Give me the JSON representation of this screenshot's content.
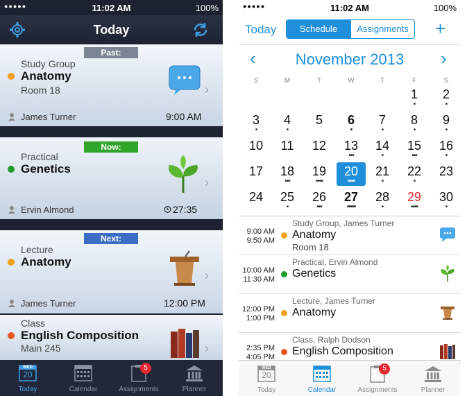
{
  "left": {
    "status": {
      "signal": "●●●●●",
      "time": "11:02 AM",
      "battery": "100%"
    },
    "header": {
      "title": "Today"
    },
    "cards": [
      {
        "tag": "Past:",
        "type": "Study Group",
        "name": "Anatomy",
        "room": "Room 18",
        "person": "James Turner",
        "time": "9:00 AM",
        "dot": "#f0a020",
        "icon": "speech-bubble-icon"
      },
      {
        "tag": "Now:",
        "type": "Practical",
        "name": "Genetics",
        "room": "",
        "person": "Ervin Almond",
        "time": "27:35",
        "dot": "#1f9a2c",
        "icon": "leaf-icon"
      },
      {
        "tag": "Next:",
        "type": "Lecture",
        "name": "Anatomy",
        "room": "",
        "person": "James Turner",
        "time": "12:00 PM",
        "dot": "#f0a020",
        "icon": "podium-icon"
      },
      {
        "tag": "",
        "type": "Class",
        "name": "English Composition",
        "room": "Main 245",
        "person": "",
        "time": "",
        "dot": "#ee5a1e",
        "icon": "books-icon"
      }
    ],
    "tabs": [
      {
        "label": "Today",
        "cal": "WED",
        "num": "20"
      },
      {
        "label": "Calendar"
      },
      {
        "label": "Assignments",
        "badge": "5"
      },
      {
        "label": "Planner"
      }
    ]
  },
  "right": {
    "status": {
      "signal": "●●●●●",
      "time": "11:02 AM",
      "battery": "100%"
    },
    "header": {
      "today": "Today",
      "seg": [
        "Schedule",
        "Assignments"
      ],
      "plus": "+"
    },
    "calendar": {
      "month": "November 2013",
      "prev": "‹",
      "next": "›",
      "weekdays": [
        "S",
        "M",
        "T",
        "W",
        "T",
        "F",
        "S"
      ],
      "weeks": [
        [
          "",
          "",
          "",
          "",
          "",
          "1",
          "2"
        ],
        [
          "3",
          "4",
          "5",
          "6",
          "7",
          "8",
          "9"
        ],
        [
          "10",
          "11",
          "12",
          "13",
          "14",
          "15",
          "16"
        ],
        [
          "17",
          "18",
          "19",
          "20",
          "21",
          "22",
          "23"
        ],
        [
          "24",
          "25",
          "26",
          "27",
          "28",
          "29",
          "30"
        ]
      ]
    },
    "agenda": [
      {
        "start": "9:00 AM",
        "end": "9:50 AM",
        "head": "Study Group, James Turner",
        "name": "Anatomy",
        "room": "Room 18",
        "dot": "#f0a020"
      },
      {
        "start": "10:00 AM",
        "end": "11:30 AM",
        "head": "Practical, Ervin Almond",
        "name": "Genetics",
        "room": "",
        "dot": "#1f9a2c"
      },
      {
        "start": "12:00 PM",
        "end": "1:00 PM",
        "head": "Lecture, James Turner",
        "name": "Anatomy",
        "room": "",
        "dot": "#f0a020"
      },
      {
        "start": "2:35 PM",
        "end": "4:05 PM",
        "head": "Class, Ralph Dodson",
        "name": "English Composition",
        "room": "",
        "dot": "#ee5a1e"
      }
    ],
    "tabs": [
      {
        "label": "Today",
        "cal": "WED",
        "num": "20"
      },
      {
        "label": "Calendar"
      },
      {
        "label": "Assignments",
        "badge": "5"
      },
      {
        "label": "Planner"
      }
    ]
  },
  "colors": {
    "accent": "#1f8fdc",
    "past_tag": "#7b8594",
    "now_tag": "#2fa52a",
    "next_tag": "#3a6dc4"
  }
}
